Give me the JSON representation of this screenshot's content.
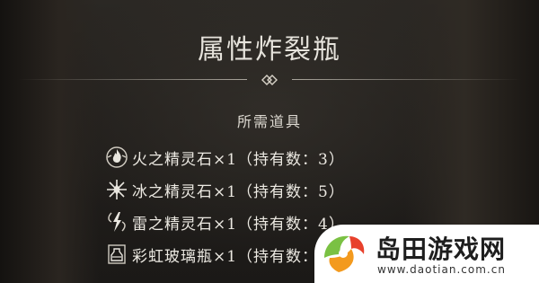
{
  "dialog": {
    "title": "属性炸裂瓶",
    "section_label": "所需道具",
    "items": [
      {
        "icon": "fire-spirit-stone-icon",
        "label": "火之精灵石×1（持有数：3）"
      },
      {
        "icon": "ice-spirit-stone-icon",
        "label": "冰之精灵石×1（持有数：5）"
      },
      {
        "icon": "thunder-spirit-stone-icon",
        "label": "雷之精灵石×1（持有数：4）"
      },
      {
        "icon": "rainbow-glass-bottle-icon",
        "label": "彩虹玻璃瓶×1（持有数：1）"
      }
    ]
  },
  "watermark": {
    "name": "岛田游戏网",
    "url": "www.daotian.com.cn"
  },
  "colors": {
    "text": "#ece9e2",
    "logo_green": "#7ac143",
    "logo_orange": "#f39a1e",
    "logo_red": "#e8412c"
  }
}
